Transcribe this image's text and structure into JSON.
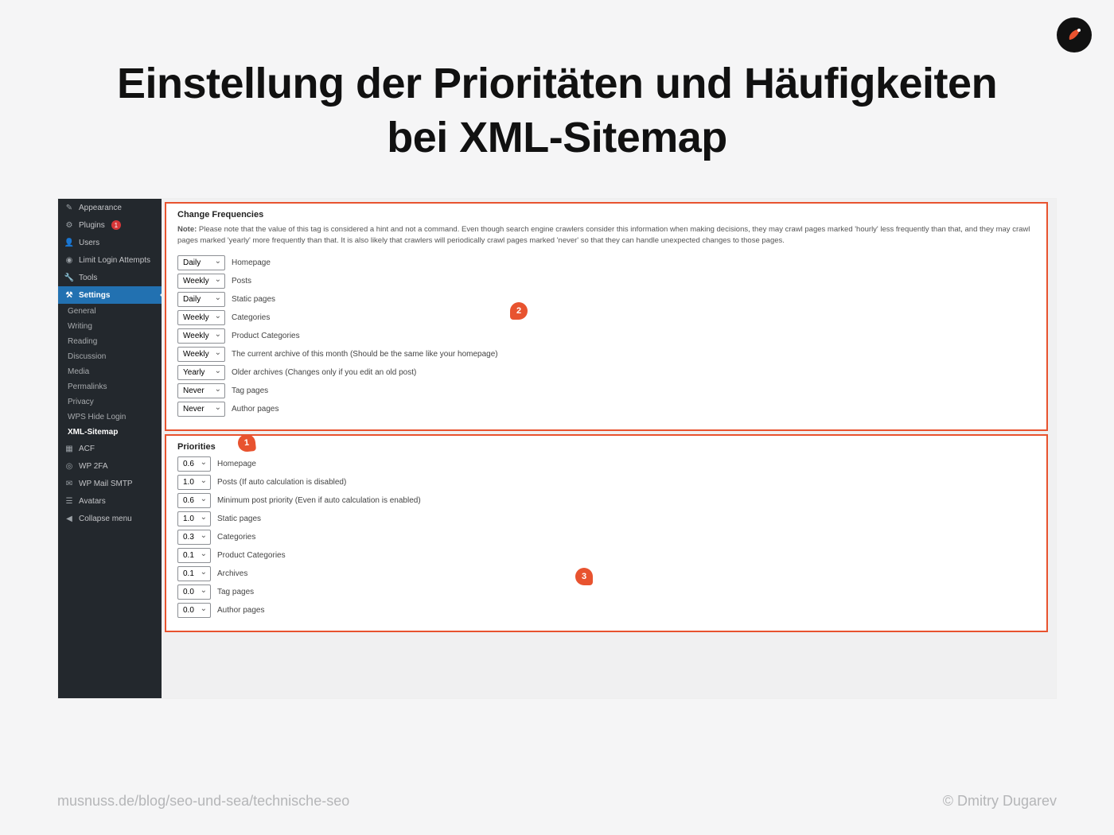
{
  "page": {
    "title": "Einstellung der Prioritäten und Häufigkeiten bei XML-Sitemap"
  },
  "footer": {
    "url": "musnuss.de/blog/seo-und-sea/technische-seo",
    "credit": "© Dmitry Dugarev"
  },
  "markers": {
    "m1": "1",
    "m2": "2",
    "m3": "3"
  },
  "sidebar": {
    "top": [
      {
        "icon": "brush",
        "label": "Appearance"
      },
      {
        "icon": "plug",
        "label": "Plugins",
        "badge": "1"
      },
      {
        "icon": "user",
        "label": "Users"
      },
      {
        "icon": "finger",
        "label": "Limit Login Attempts"
      },
      {
        "icon": "wrench",
        "label": "Tools"
      }
    ],
    "settings_label": "Settings",
    "sub": [
      "General",
      "Writing",
      "Reading",
      "Discussion",
      "Media",
      "Permalinks",
      "Privacy",
      "WPS Hide Login",
      "XML-Sitemap"
    ],
    "bottom": [
      {
        "icon": "grid",
        "label": "ACF"
      },
      {
        "icon": "shield",
        "label": "WP 2FA"
      },
      {
        "icon": "mail",
        "label": "WP Mail SMTP"
      },
      {
        "icon": "avatar",
        "label": "Avatars"
      },
      {
        "icon": "collapse",
        "label": "Collapse menu"
      }
    ]
  },
  "freq": {
    "title": "Change Frequencies",
    "note_label": "Note:",
    "note": "Please note that the value of this tag is considered a hint and not a command. Even though search engine crawlers consider this information when making decisions, they may crawl pages marked 'hourly' less frequently than that, and they may crawl pages marked 'yearly' more frequently than that. It is also likely that crawlers will periodically crawl pages marked 'never' so that they can handle unexpected changes to those pages.",
    "rows": [
      {
        "value": "Daily",
        "label": "Homepage"
      },
      {
        "value": "Weekly",
        "label": "Posts"
      },
      {
        "value": "Daily",
        "label": "Static pages"
      },
      {
        "value": "Weekly",
        "label": "Categories"
      },
      {
        "value": "Weekly",
        "label": "Product Categories"
      },
      {
        "value": "Weekly",
        "label": "The current archive of this month (Should be the same like your homepage)"
      },
      {
        "value": "Yearly",
        "label": "Older archives (Changes only if you edit an old post)"
      },
      {
        "value": "Never",
        "label": "Tag pages"
      },
      {
        "value": "Never",
        "label": "Author pages"
      }
    ]
  },
  "prio": {
    "title": "Priorities",
    "rows": [
      {
        "value": "0.6",
        "label": "Homepage"
      },
      {
        "value": "1.0",
        "label": "Posts (If auto calculation is disabled)"
      },
      {
        "value": "0.6",
        "label": "Minimum post priority (Even if auto calculation is enabled)"
      },
      {
        "value": "1.0",
        "label": "Static pages"
      },
      {
        "value": "0.3",
        "label": "Categories"
      },
      {
        "value": "0.1",
        "label": "Product Categories"
      },
      {
        "value": "0.1",
        "label": "Archives"
      },
      {
        "value": "0.0",
        "label": "Tag pages"
      },
      {
        "value": "0.0",
        "label": "Author pages"
      }
    ]
  }
}
